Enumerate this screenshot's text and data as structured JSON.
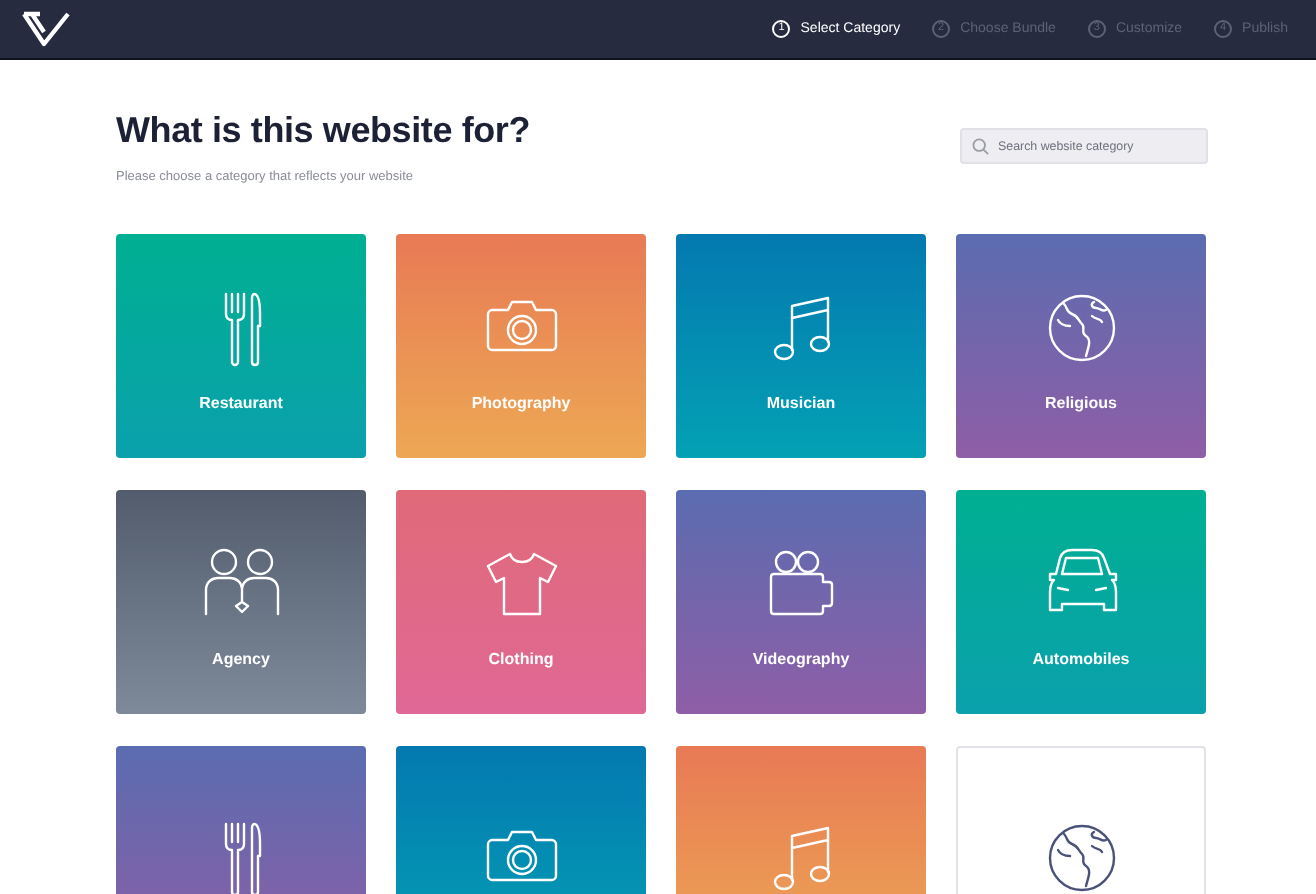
{
  "steps": [
    {
      "number": "1",
      "label": "Select Category",
      "selected": true
    },
    {
      "number": "2",
      "label": "Choose Bundle",
      "selected": false
    },
    {
      "number": "3",
      "label": "Customize",
      "selected": false
    },
    {
      "number": "4",
      "label": "Publish",
      "selected": false
    }
  ],
  "heading": "What is this website for?",
  "subheading": "Please choose a category that reflects your website",
  "search": {
    "placeholder": "Search website category"
  },
  "categories": [
    {
      "label": "Restaurant",
      "kind": "dining",
      "color": "#00b092"
    },
    {
      "label": "Photography",
      "kind": "camera",
      "color": "#e87a55"
    },
    {
      "label": "Musician",
      "kind": "music",
      "color": "#0479b0"
    },
    {
      "label": "Religious",
      "kind": "globe",
      "color": "#5b6cb0"
    },
    {
      "label": "Agency",
      "kind": "people",
      "color": "#525c6c"
    },
    {
      "label": "Clothing",
      "kind": "shirt",
      "color": "#e06a78"
    },
    {
      "label": "Videography",
      "kind": "video",
      "color": "#5b6cb0"
    },
    {
      "label": "Automobiles",
      "kind": "car",
      "color": "#00b092"
    },
    {
      "kind": "dining",
      "color": "#5b6cb0"
    },
    {
      "kind": "camera",
      "color": "#0479b0"
    },
    {
      "kind": "music",
      "color": "#e87a55"
    },
    {
      "kind": "globe",
      "color": "#ffffff"
    }
  ]
}
